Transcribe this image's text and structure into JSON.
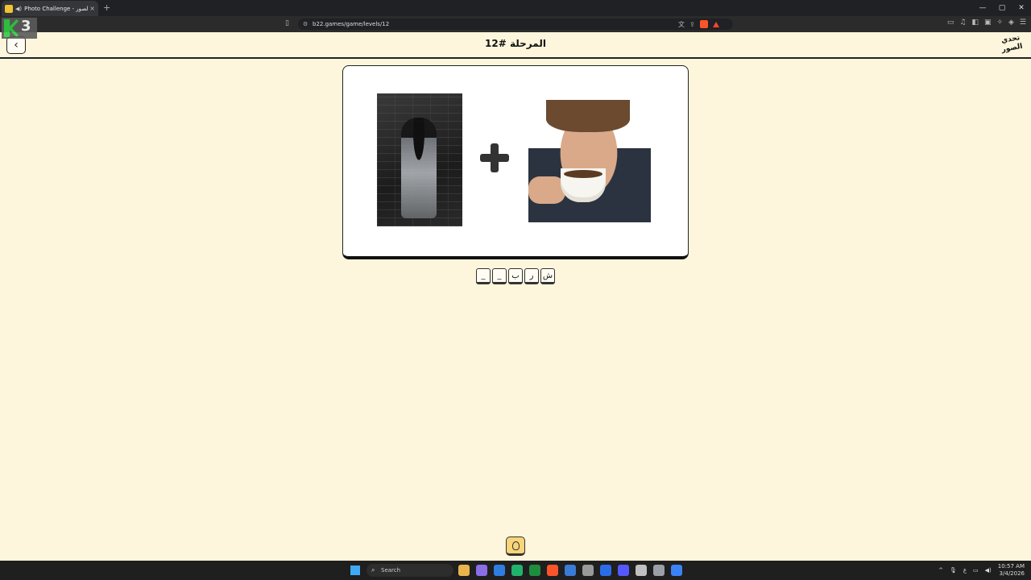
{
  "browser": {
    "tab_title": "Photo Challenge - تحدي الصور",
    "tab_audio_icon": "speaker-icon",
    "close_tab": "×",
    "new_tab": "+",
    "window_controls": [
      "—",
      "▢",
      "✕"
    ],
    "url": "b22.games/game/levels/12",
    "overlay_badge": "3"
  },
  "header": {
    "back_label": "‹",
    "title": "المرحلة #12",
    "logo_text": "تحدي الصور"
  },
  "puzzle": {
    "image_left": "ghost-woman-image",
    "image_right": "man-drinking-coffee-image",
    "operator": "+"
  },
  "answer": {
    "slots": [
      "ش",
      "ر",
      "ب",
      "_",
      "_"
    ]
  },
  "hint": {
    "icon": "lightbulb-icon"
  },
  "taskbar": {
    "search_label": "Search",
    "clock_time": "10:57 AM",
    "clock_date": "3/4/2026",
    "lang": "ع",
    "app_colors": [
      "#e8b44c",
      "#8a6ee8",
      "#2f7de1",
      "#21b36b",
      "#1e8e3e",
      "#fb542b",
      "#3a7bd5",
      "#999999",
      "#2b6de8",
      "#5558ff",
      "#c0c0c0",
      "#9aa0a6",
      "#3b82f6"
    ]
  }
}
